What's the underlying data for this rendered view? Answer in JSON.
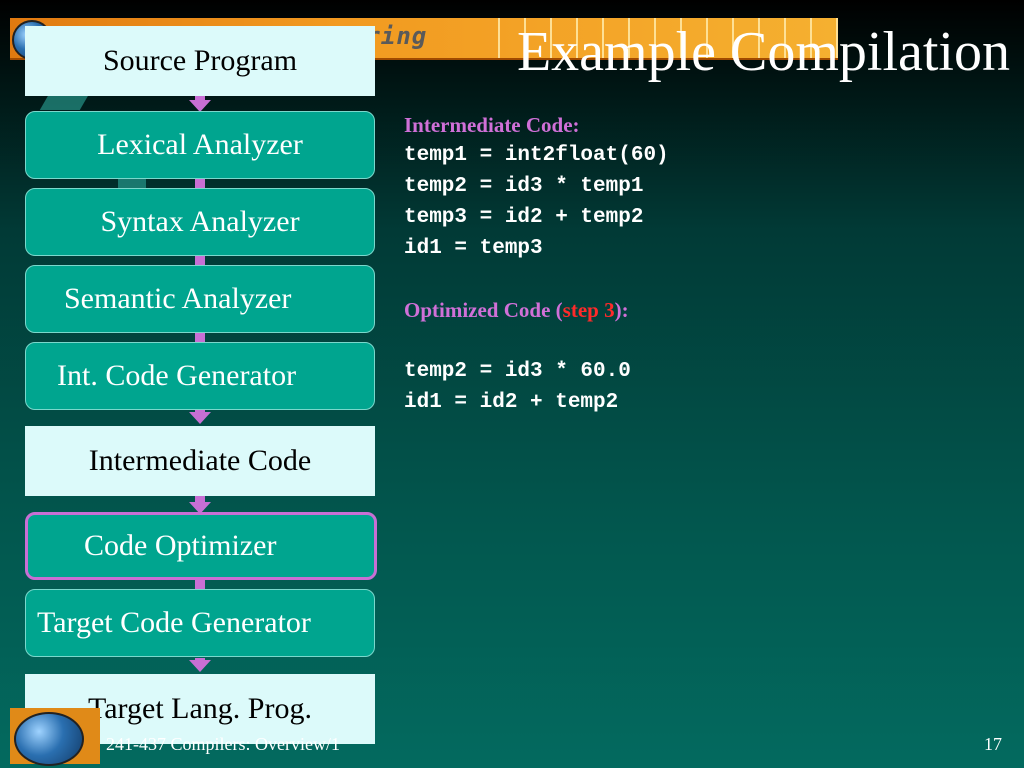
{
  "banner": {
    "logo_text": "ering"
  },
  "slide": {
    "title": "Example Compilation"
  },
  "pipeline": {
    "stages": [
      {
        "label": "Source Program",
        "kind": "data"
      },
      {
        "label": "Lexical Analyzer",
        "kind": "process"
      },
      {
        "label": "Syntax Analyzer",
        "kind": "process"
      },
      {
        "label": "Semantic Analyzer",
        "kind": "process"
      },
      {
        "label": "Int. Code Generator",
        "kind": "process"
      },
      {
        "label": "Intermediate Code",
        "kind": "data"
      },
      {
        "label": "Code Optimizer",
        "kind": "process",
        "highlighted": true
      },
      {
        "label": "Target Code Generator",
        "kind": "process"
      },
      {
        "label": "Target Lang. Prog.",
        "kind": "data"
      }
    ]
  },
  "code": {
    "intermediate_heading": "Intermediate Code:",
    "intermediate_lines": [
      "temp1 = int2float(60)",
      "temp2 = id3 * temp1",
      "temp3 = id2 + temp2",
      "id1 = temp3"
    ],
    "optimized_heading_prefix": "Optimized Code (",
    "optimized_heading_step": "step 3",
    "optimized_heading_suffix": "):",
    "optimized_lines": [
      "temp2 = id3 * 60.0",
      "id1 = id2 + temp2"
    ]
  },
  "footer": {
    "course": "241-437 Compilers: Overview/1",
    "page": "17"
  },
  "colors": {
    "process_fill": "#00a58f",
    "data_fill": "#dcfafa",
    "connector": "#c86fd4",
    "heading": "#d070d8",
    "step_highlight": "#ff2a2a"
  }
}
